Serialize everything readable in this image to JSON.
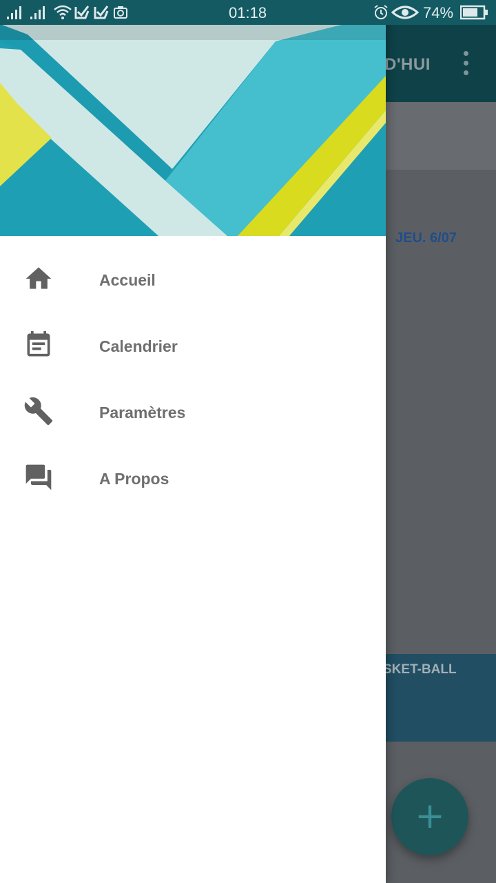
{
  "status_bar": {
    "time": "01:18",
    "battery_percent": "74%",
    "icons": [
      "signal-icon",
      "signal-icon",
      "wifi-icon",
      "check-notification-icon",
      "check-notification-icon",
      "camera-icon",
      "alarm-icon",
      "eye-icon",
      "battery-icon"
    ],
    "battery_level": 0.74
  },
  "background_app": {
    "toolbar_title_fragment": "D'HUI",
    "date_tab": "JEU. 6/07",
    "event_label_fragment": "SKET-BALL",
    "fab_symbol": "+"
  },
  "drawer": {
    "menu": [
      {
        "label": "Accueil",
        "icon": "home-icon"
      },
      {
        "label": "Calendrier",
        "icon": "calendar-icon"
      },
      {
        "label": "Paramètres",
        "icon": "wrench-icon"
      },
      {
        "label": "A Propos",
        "icon": "forum-icon"
      }
    ]
  },
  "colors": {
    "toolbar": "#0e4248",
    "header_teal": "#1f9fb4",
    "header_light": "#cfe8e6",
    "header_yellow": "#dcdc20",
    "menu_text": "#6f6f6f",
    "icon_gray": "#616161"
  }
}
